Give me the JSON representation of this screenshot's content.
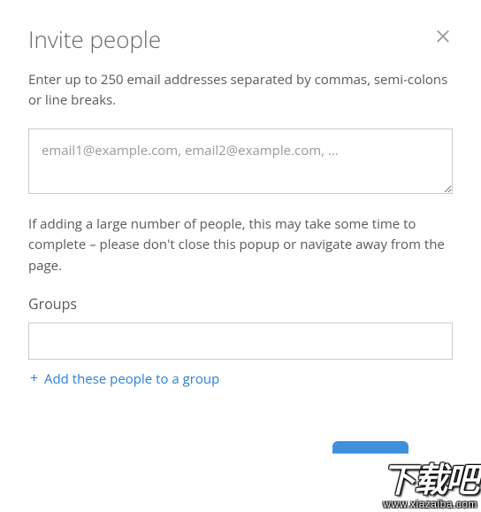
{
  "dialog": {
    "title": "Invite people",
    "instruction": "Enter up to 250 email addresses separated by commas, semi-colons or line breaks.",
    "email_placeholder": "email1@example.com, email2@example.com, ...",
    "email_value": "",
    "warning": "If adding a large number of people, this may take some time to complete – please don't close this popup or navigate away from the page.",
    "groups_label": "Groups",
    "groups_value": "",
    "add_group_link": "Add these people to a group"
  },
  "watermark": {
    "brand": "下载吧",
    "url": "www.xiazaiba.com"
  }
}
